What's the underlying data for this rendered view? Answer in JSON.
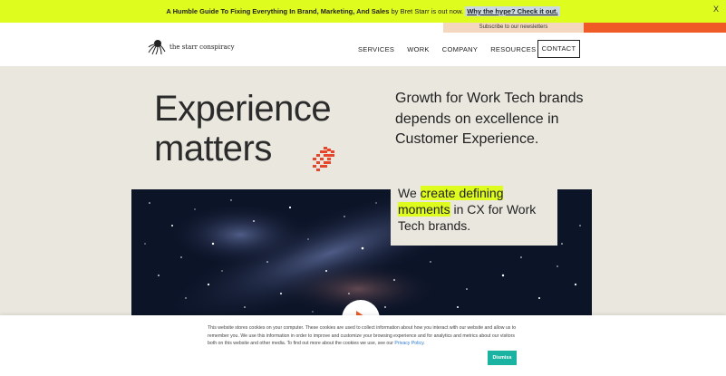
{
  "announcement": {
    "strong_text": "A Humble Guide To Fixing Everything In Brand, Marketing, And Sales",
    "normal_text": " by Bret Starr is out now. ",
    "link_text": "Why the hype? Check it out.",
    "close_label": "X"
  },
  "newsletter": {
    "label": "Subscribe to our newsletters"
  },
  "header": {
    "logo_text": "the starr conspiracy",
    "nav": [
      "SERVICES",
      "WORK",
      "COMPANY",
      "RESOURCES"
    ],
    "contact_label": "CONTACT"
  },
  "hero": {
    "title_line1": "Experience",
    "title_line2": "matters",
    "subtitle": "Growth for Work Tech brands depends on excellence in Customer Experience."
  },
  "cx_box": {
    "before": "We ",
    "highlight1": "create defining",
    "highlight2": "moments",
    "after": " in CX for Work Tech brands."
  },
  "cookie": {
    "text": "This website stores cookies on your computer. These cookies are used to collect information about how you interact with our website and allow us to remember you. We use this information in order to improve and customize your browsing experience and for analytics and metrics about our visitors both on this website and other media. To find out more about the cookies we use, see our ",
    "link": "Privacy Policy",
    "end": ".",
    "dismiss_label": "Dismiss"
  },
  "colors": {
    "accent_lime": "#dffc1f",
    "accent_orange": "#f05a26",
    "background": "#e9e7de",
    "dismiss": "#1ab3a1"
  },
  "icons": [
    "octopus-logo-icon",
    "pixel-fire-icon",
    "play-icon",
    "close-icon"
  ]
}
